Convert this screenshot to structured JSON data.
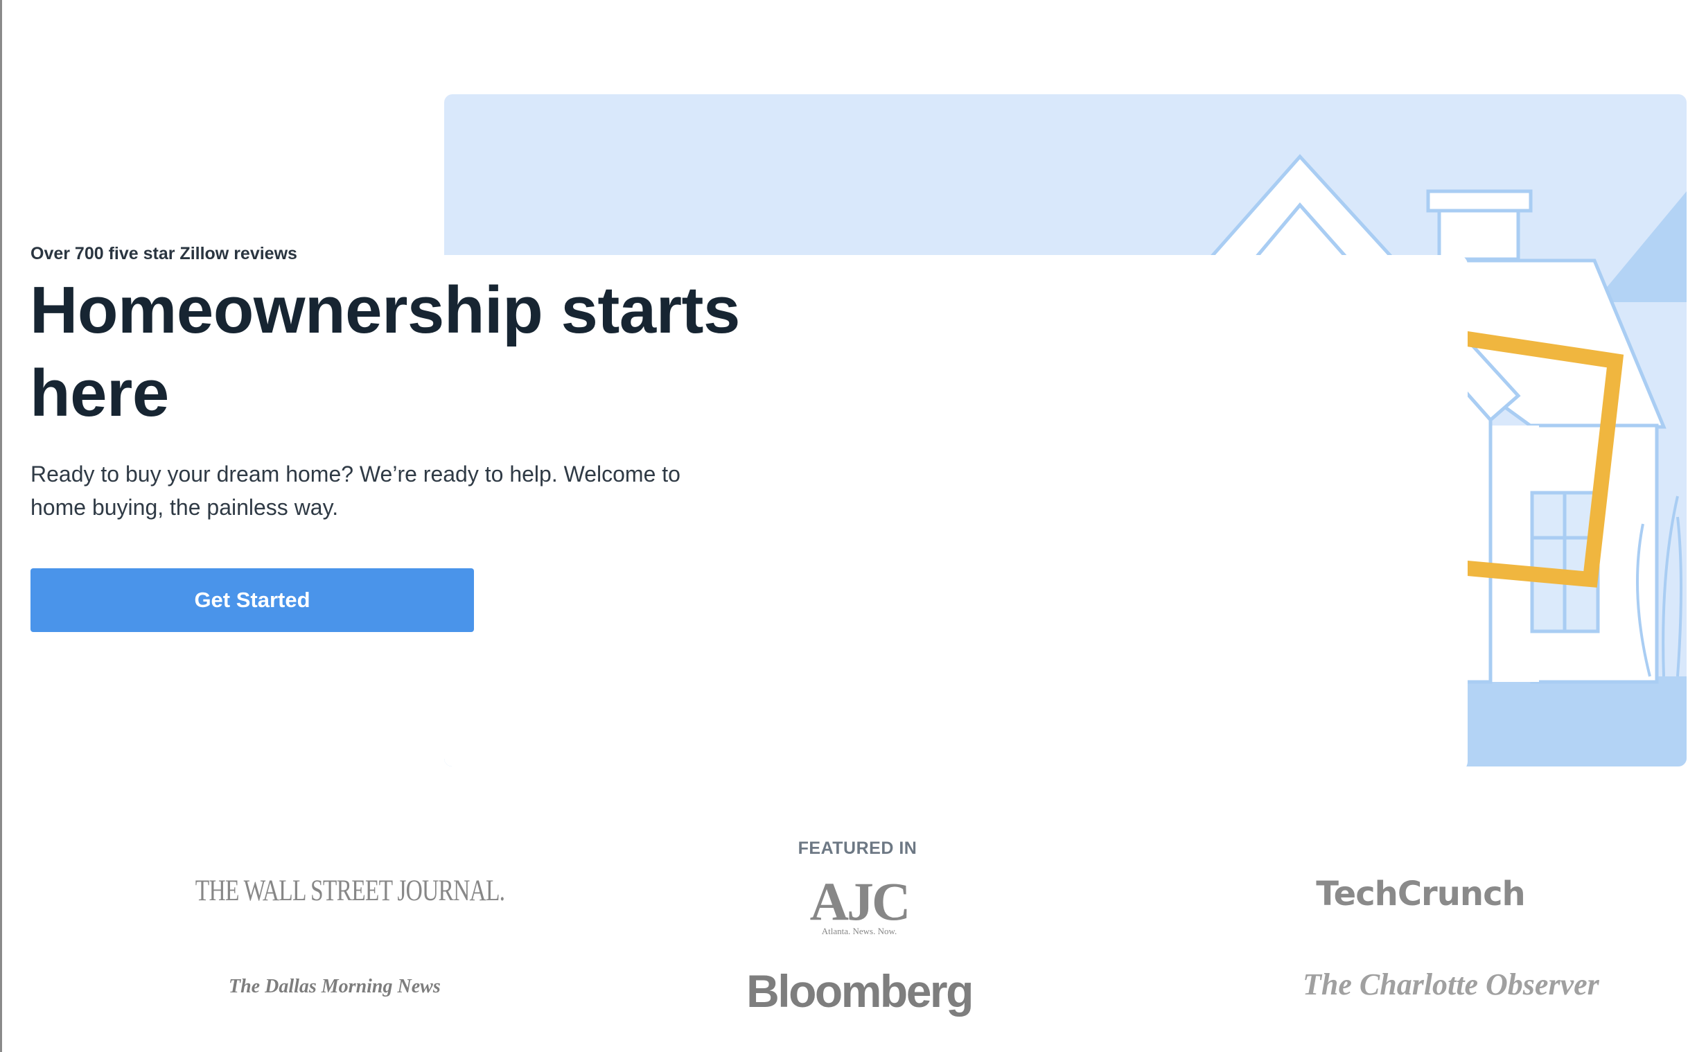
{
  "hero": {
    "eyebrow": "Over 700 five star Zillow reviews",
    "headline": "Homeownership starts here",
    "subtext": "Ready to buy your dream home? We’re ready to help. Welcome to home buying, the painless way.",
    "cta_label": "Get Started",
    "illustration": "couple-holding-frame-in-front-of-house"
  },
  "featured": {
    "title": "FEATURED IN",
    "logos": [
      {
        "name": "wsj",
        "text": "THE WALL STREET JOURNAL."
      },
      {
        "name": "ajc",
        "text": "AJC",
        "tagline": "Atlanta. News. Now."
      },
      {
        "name": "techcrunch",
        "text": "TechCrunch"
      },
      {
        "name": "dallas-morning-news",
        "text": "The Dallas Morning News"
      },
      {
        "name": "bloomberg",
        "text": "Bloomberg"
      },
      {
        "name": "charlotte-observer",
        "text": "The Charlotte Observer"
      }
    ]
  },
  "colors": {
    "accent": "#4a94ea",
    "hero_bg": "#d9e8fb",
    "hero_bg_dark": "#b3d3f5",
    "frame": "#f0b63f",
    "heading": "#172532"
  }
}
